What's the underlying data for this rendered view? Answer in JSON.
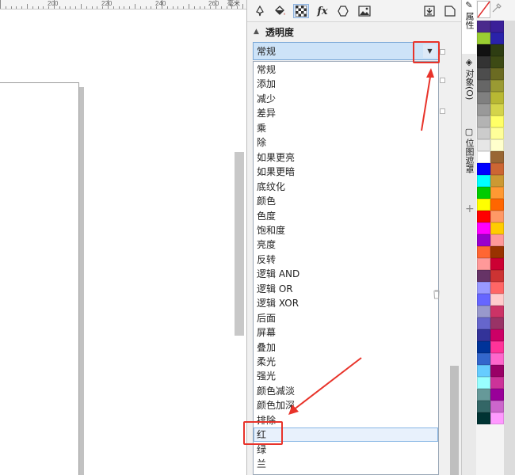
{
  "ruler": {
    "labels": [
      "200",
      "220",
      "240",
      "260"
    ],
    "unit": "毫米"
  },
  "docker": {
    "tab_icons": [
      "pen-icon",
      "fill-icon",
      "transparency-icon",
      "fx-icon",
      "hexagon-icon",
      "bitmap-icon",
      "import-icon",
      "copy-icon"
    ],
    "section_title": "透明度",
    "merge_mode": {
      "selected": "常规",
      "options": [
        "常规",
        "添加",
        "减少",
        "差异",
        "乘",
        "除",
        "如果更亮",
        "如果更暗",
        "底纹化",
        "颜色",
        "色度",
        "饱和度",
        "亮度",
        "反转",
        "逻辑 AND",
        "逻辑 OR",
        "逻辑 XOR",
        "后面",
        "屏幕",
        "叠加",
        "柔光",
        "强光",
        "颜色减淡",
        "颜色加深",
        "排除",
        "红",
        "绿",
        "兰"
      ],
      "hovered": "红"
    }
  },
  "vertical_tabs": [
    {
      "label": "属性",
      "icon": "properties-icon",
      "active": true
    },
    {
      "label": "对象(O)",
      "icon": "layers-icon",
      "active": false
    },
    {
      "label": "位图遮罩",
      "icon": "bitmap-mask-icon",
      "active": false
    }
  ],
  "palette": {
    "colors": [
      "#4a2a8c",
      "#3a1f99",
      "#9acd32",
      "#2a22aa",
      "#111111",
      "#2e3d12",
      "#333333",
      "#3d4a14",
      "#4d4d4d",
      "#6b6b22",
      "#666666",
      "#9a9a33",
      "#808080",
      "#b8b833",
      "#999999",
      "#d4d44a",
      "#b3b3b3",
      "#ffff66",
      "#cccccc",
      "#ffff99",
      "#e6e6e6",
      "#ffffcc",
      "#ffffff",
      "#996633",
      "#0000ff",
      "#cc6633",
      "#00ffff",
      "#cc9933",
      "#00cc00",
      "#ff9933",
      "#ffff00",
      "#ff6600",
      "#ff0000",
      "#ff9966",
      "#ff00ff",
      "#ffcc00",
      "#9900cc",
      "#ff9999",
      "#ff6633",
      "#993300",
      "#ff9999",
      "#cc0033",
      "#663366",
      "#cc3333",
      "#9999ff",
      "#ff6666",
      "#6666ff",
      "#ffcccc",
      "#9999cc",
      "#cc3366",
      "#6666cc",
      "#993366",
      "#333399",
      "#cc0066",
      "#003399",
      "#ff3399",
      "#3366cc",
      "#ff66cc",
      "#66ccff",
      "#990066",
      "#99ffff",
      "#cc3399",
      "#669999",
      "#990099",
      "#336666",
      "#cc66cc",
      "#003333",
      "#ff99ff"
    ]
  }
}
